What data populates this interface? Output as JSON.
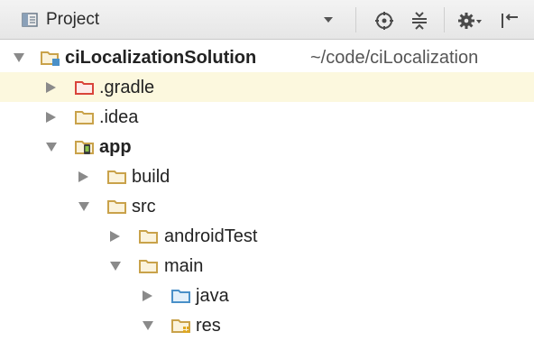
{
  "toolbar": {
    "title": "Project",
    "icons": [
      "project-view-icon",
      "dropdown-arrow-icon",
      "target-icon",
      "collapse-all-icon",
      "gear-icon",
      "hide-panel-icon"
    ]
  },
  "tree": [
    {
      "label": "ciLocalizationSolution",
      "path": "~/code/ciLocalization",
      "expanded": true,
      "folder_type": "project-module"
    },
    {
      "label": ".gradle",
      "expanded": false,
      "folder_type": "excluded",
      "selected": true
    },
    {
      "label": ".idea",
      "expanded": false,
      "folder_type": "plain"
    },
    {
      "label": "app",
      "expanded": true,
      "folder_type": "android-module"
    },
    {
      "label": "build",
      "expanded": false,
      "folder_type": "plain"
    },
    {
      "label": "src",
      "expanded": true,
      "folder_type": "plain"
    },
    {
      "label": "androidTest",
      "expanded": false,
      "folder_type": "plain"
    },
    {
      "label": "main",
      "expanded": true,
      "folder_type": "plain"
    },
    {
      "label": "java",
      "expanded": false,
      "folder_type": "source"
    },
    {
      "label": "res",
      "expanded": true,
      "folder_type": "resources"
    }
  ],
  "colors": {
    "folder": "#c9a24a",
    "excluded_folder": "#d9443a",
    "source_folder": "#4a90c8",
    "selection": "#fcf8de"
  }
}
